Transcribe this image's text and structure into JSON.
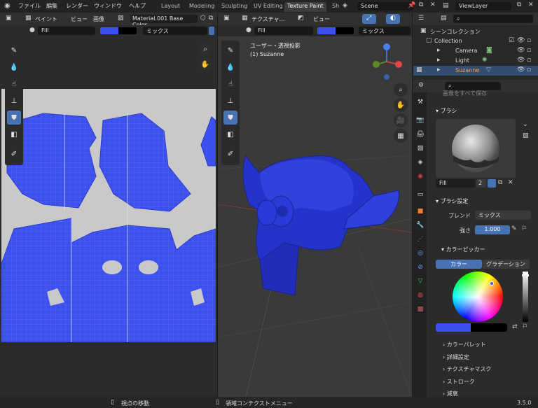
{
  "menu": {
    "items": [
      "ファイル",
      "編集",
      "レンダー",
      "ウィンドウ",
      "ヘルプ"
    ]
  },
  "workspace_tabs": [
    {
      "label": "Layout",
      "active": false
    },
    {
      "label": "Modeling",
      "active": false
    },
    {
      "label": "Sculpting",
      "active": false
    },
    {
      "label": "UV Editing",
      "active": false
    },
    {
      "label": "Texture Paint",
      "active": true
    },
    {
      "label": "Sh",
      "active": false
    }
  ],
  "scene": {
    "name": "Scene",
    "view_layer": "ViewLayer"
  },
  "image_editor": {
    "mode": "ペイント",
    "view_menu": "ビュー",
    "image_menu": "画像",
    "image_name": "Material.001 Base Color",
    "brush_name": "Fill",
    "blend": "ミックス"
  },
  "viewport": {
    "mode": "テクスチャ...",
    "view_menu": "ビュー",
    "brush_name": "Fill",
    "blend": "ミックス",
    "overlay_title": "ユーザー・透視投影",
    "overlay_object": "(1) Suzanne"
  },
  "outliner": {
    "scene_collection": "シーンコレクション",
    "items": [
      {
        "label": "Collection",
        "icon": "collection-icon",
        "selected": false
      },
      {
        "label": "Camera",
        "icon": "camera-icon",
        "selected": false
      },
      {
        "label": "Light",
        "icon": "light-icon",
        "selected": false
      },
      {
        "label": "Suzanne",
        "icon": "mesh-icon",
        "selected": true
      }
    ]
  },
  "properties": {
    "hint": "画像をすべて保存",
    "brush_panel": "ブラシ",
    "brush_name": "Fill",
    "brush_users": "2",
    "brush_settings": "ブラシ設定",
    "blend_label": "ブレンド",
    "blend_value": "ミックス",
    "strength_label": "強さ",
    "strength_value": "1.000",
    "color_picker": "カラーピッカー",
    "color_tab": "カラー",
    "gradient_tab": "グラデーション",
    "subpanels": [
      "カラーパレット",
      "詳細設定",
      "テクスチャマスク",
      "ストローク",
      "減衰"
    ]
  },
  "status": {
    "left": "視点の移動",
    "middle": "領域コンテクストメニュー",
    "version": "3.5.0"
  },
  "colors": {
    "accent": "#4772b3",
    "paint_blue": "#3c50f0",
    "suzanne_blue": "#2433c9"
  }
}
